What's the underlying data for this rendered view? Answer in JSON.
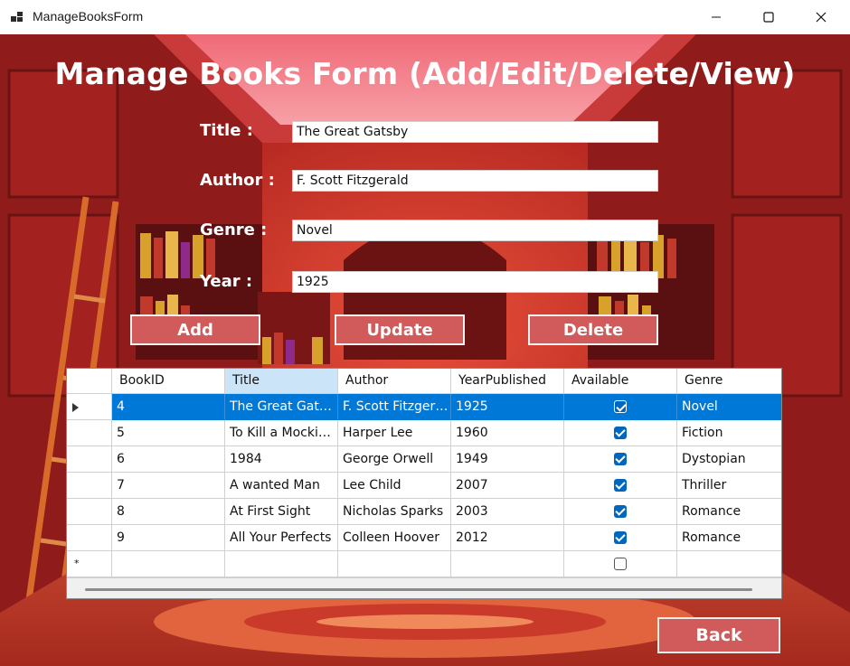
{
  "window": {
    "title": "ManageBooksForm"
  },
  "heading": "Manage Books Form (Add/Edit/Delete/View)",
  "form": {
    "title_label": "Title :",
    "title_value": "The Great Gatsby",
    "author_label": "Author :",
    "author_value": "F. Scott Fitzgerald",
    "genre_label": "Genre :",
    "genre_value": "Novel",
    "year_label": "Year :",
    "year_value": "1925"
  },
  "buttons": {
    "add": "Add",
    "update": "Update",
    "delete": "Delete",
    "back": "Back"
  },
  "grid": {
    "columns": [
      "BookID",
      "Title",
      "Author",
      "YearPublished",
      "Available",
      "Genre"
    ],
    "rows": [
      {
        "id": "4",
        "title": "The Great Gatsby",
        "author": "F. Scott Fitzgera...",
        "year": "1925",
        "available": true,
        "genre": "Novel",
        "selected": true
      },
      {
        "id": "5",
        "title": "To Kill a Mockin...",
        "author": "Harper Lee",
        "year": "1960",
        "available": true,
        "genre": "Fiction"
      },
      {
        "id": "6",
        "title": "1984",
        "author": "George Orwell",
        "year": "1949",
        "available": true,
        "genre": "Dystopian"
      },
      {
        "id": "7",
        "title": "A wanted Man",
        "author": "Lee Child",
        "year": "2007",
        "available": true,
        "genre": "Thriller"
      },
      {
        "id": "8",
        "title": "At First Sight",
        "author": "Nicholas Sparks",
        "year": "2003",
        "available": true,
        "genre": "Romance"
      },
      {
        "id": "9",
        "title": "All Your Perfects",
        "author": "Colleen Hoover",
        "year": "2012",
        "available": true,
        "genre": "Romance"
      }
    ],
    "new_row_marker": "*"
  },
  "colors": {
    "button_bg": "#d15a5a",
    "selection": "#0078d7",
    "checkbox": "#0067c0"
  }
}
